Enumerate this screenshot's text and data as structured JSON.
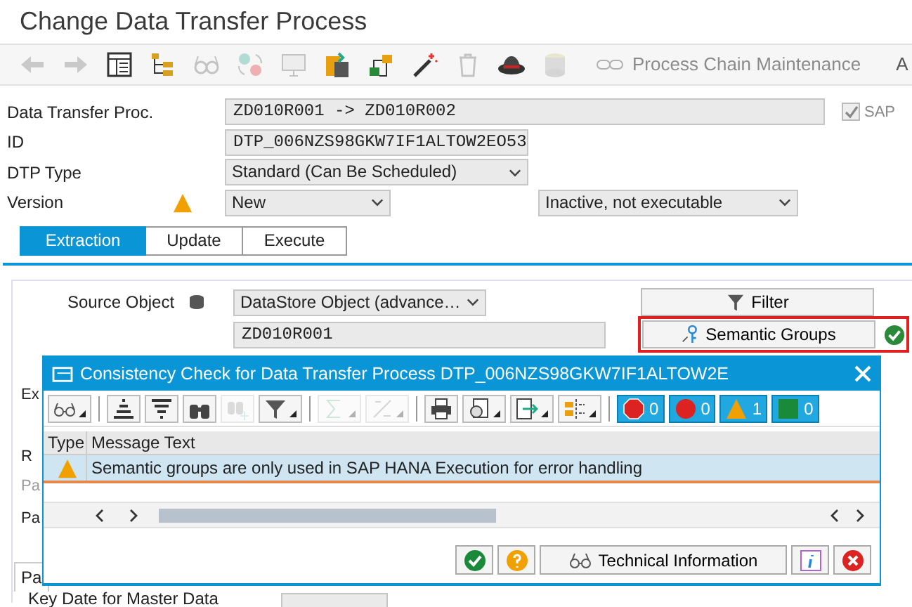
{
  "window": {
    "title": "Change Data Transfer Process"
  },
  "toolbar": {
    "buttons": [
      {
        "kind": "back",
        "disabled": true
      },
      {
        "kind": "forward",
        "disabled": true
      },
      {
        "kind": "table",
        "disabled": false
      },
      {
        "kind": "hierarchy",
        "disabled": false
      },
      {
        "kind": "glasses",
        "disabled": true
      },
      {
        "kind": "cycle",
        "disabled": true
      },
      {
        "kind": "monitor",
        "disabled": true
      },
      {
        "kind": "paste",
        "disabled": false
      },
      {
        "kind": "transport",
        "disabled": false
      },
      {
        "kind": "wand",
        "disabled": false
      },
      {
        "kind": "trash",
        "disabled": true
      },
      {
        "kind": "hat",
        "disabled": false
      },
      {
        "kind": "stack",
        "disabled": true
      }
    ],
    "link": {
      "label": "Process Chain Maintenance",
      "disabled": true
    },
    "cut_label": "A"
  },
  "header": {
    "data_transfer_proc": {
      "label": "Data Transfer Proc.",
      "value": "ZD010R001 -> ZD010R002"
    },
    "sap_checkbox": {
      "label": "SAP",
      "checked": true
    },
    "id": {
      "label": "ID",
      "value": "DTP_006NZS98GKW7IF1ALTOW2EO53"
    },
    "dtp_type": {
      "label": "DTP Type",
      "value": "Standard (Can Be Scheduled)"
    },
    "version": {
      "label": "Version",
      "value": "New",
      "status": "Inactive, not executable"
    }
  },
  "tabs": [
    {
      "label": "Extraction",
      "selected": true
    },
    {
      "label": "Update",
      "selected": false
    },
    {
      "label": "Execute",
      "selected": false
    }
  ],
  "extraction": {
    "source_object": {
      "label": "Source Object",
      "type": "DataStore Object (advance…",
      "name": "ZD010R001"
    },
    "filter_button": {
      "label": "Filter"
    },
    "semantic_groups_button": {
      "label": "Semantic Groups",
      "highlighted": true
    },
    "hidden_labels": [
      {
        "text": "Ex",
        "muted": false
      },
      {
        "text": "R",
        "muted": false
      },
      {
        "text": "Pa",
        "muted": true
      },
      {
        "text": "Pa",
        "muted": false
      }
    ],
    "bottom_tab": "Pa",
    "key_date_label": "Key Date for Master Data"
  },
  "dialog": {
    "title": "Consistency Check for Data Transfer Process DTP_006NZS98GKW7IF1ALTOW2E",
    "toolbar": [
      {
        "kind": "glasses",
        "caret": true,
        "disabled": false
      },
      {
        "kind": "sep"
      },
      {
        "kind": "sort_up",
        "caret": false,
        "disabled": false
      },
      {
        "kind": "sort_down",
        "caret": false,
        "disabled": false
      },
      {
        "kind": "find",
        "caret": false,
        "disabled": false
      },
      {
        "kind": "find_next",
        "caret": false,
        "disabled": true
      },
      {
        "kind": "filter",
        "caret": true,
        "disabled": false
      },
      {
        "kind": "sep"
      },
      {
        "kind": "sum",
        "caret": true,
        "disabled": true
      },
      {
        "kind": "subtotal",
        "caret": true,
        "disabled": true
      },
      {
        "kind": "sep"
      },
      {
        "kind": "print",
        "caret": false,
        "disabled": false
      },
      {
        "kind": "views",
        "caret": true,
        "disabled": false
      },
      {
        "kind": "export",
        "caret": true,
        "disabled": false
      },
      {
        "kind": "layout",
        "caret": true,
        "disabled": false
      },
      {
        "kind": "sep"
      }
    ],
    "counters": [
      {
        "kind": "stop",
        "count": "0"
      },
      {
        "kind": "error",
        "count": "0"
      },
      {
        "kind": "warning",
        "count": "1"
      },
      {
        "kind": "success",
        "count": "0"
      }
    ],
    "columns": [
      "Type",
      "Message Text"
    ],
    "rows": [
      {
        "kind": "warning",
        "text": "Semantic groups are only used in SAP HANA Execution for error handling",
        "selected": true
      }
    ],
    "buttons": [
      {
        "kind": "ok"
      },
      {
        "kind": "help"
      },
      {
        "kind": "technical",
        "label": "Technical Information"
      },
      {
        "kind": "info"
      },
      {
        "kind": "cancel"
      }
    ]
  }
}
